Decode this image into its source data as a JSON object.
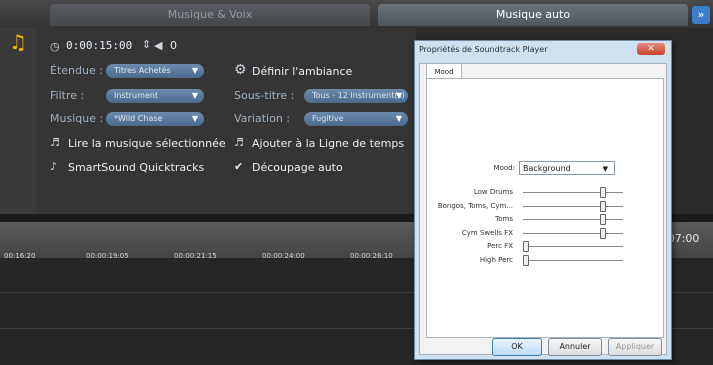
{
  "tabs": {
    "voice_music": "Musique & Voix",
    "auto_music": "Musique auto"
  },
  "icons": {
    "music": "music-note-icon",
    "scroll": "double-chevron-icon"
  },
  "panel": {
    "time_value": "0:00:15:00",
    "volume_value": "0",
    "scope_label": "Étendue :",
    "scope_value": "Titres Achetés",
    "filter_label": "Filtre :",
    "filter_value": "Instrument",
    "music_label": "Musique :",
    "music_value": "*Wild Chase",
    "define_ambience": "Définir l'ambiance",
    "subtitle_label": "Sous-titre :",
    "subtitle_value": "Tous - 12 Instrument(s)",
    "variation_label": "Variation :",
    "variation_value": "Fugitive",
    "play_selected": "Lire la musique sélectionnée",
    "add_to_timeline": "Ajouter à la Ligne de temps",
    "smartsound": "SmartSound Quicktracks",
    "auto_cut": "Découpage auto"
  },
  "timeline": {
    "ticks": [
      "00:16:20",
      "00:00:19:05",
      "00:00:21:15",
      "00:00:24:00",
      "00:00:26:10"
    ],
    "right_time": ":07:00"
  },
  "dialog": {
    "title": "Propriétés de Soundtrack Player",
    "tab": "Mood",
    "mood_label": "Mood:",
    "mood_value": "Background",
    "sliders": [
      {
        "label": "Low Drums",
        "level": 0.85
      },
      {
        "label": "Bongos, Toms, Cym...",
        "level": 0.85
      },
      {
        "label": "Toms",
        "level": 0.85
      },
      {
        "label": "Cym Swells  FX",
        "level": 0.85
      },
      {
        "label": "Perc FX",
        "level": 0.0
      },
      {
        "label": "High Perc",
        "level": 0.0
      }
    ],
    "ok": "OK",
    "cancel": "Annuler",
    "apply": "Appliquer"
  }
}
